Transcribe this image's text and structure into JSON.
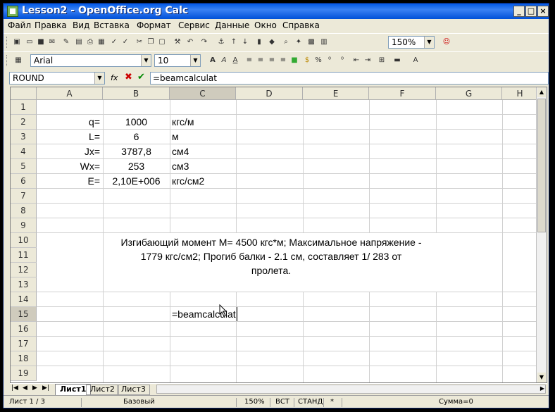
{
  "window": {
    "title": "Lesson2 - OpenOffice.org Calc",
    "controls": [
      "_",
      "□",
      "×"
    ]
  },
  "menu": [
    "Файл",
    "Правка",
    "Вид",
    "Вставка",
    "Формат",
    "Сервис",
    "Данные",
    "Окно",
    "Справка"
  ],
  "toolbar": {
    "zoom": "150%",
    "font_name": "Arial",
    "font_size": "10"
  },
  "formula_bar": {
    "name_box": "ROUND",
    "fx": "fx",
    "cancel": "✖",
    "accept": "✔",
    "content": "=beamcalculat"
  },
  "columns": [
    "A",
    "B",
    "C",
    "D",
    "E",
    "F",
    "G",
    "H"
  ],
  "rows": [
    "1",
    "2",
    "3",
    "4",
    "5",
    "6",
    "7",
    "8",
    "9",
    "10",
    "11",
    "12",
    "13",
    "14",
    "15",
    "16",
    "17",
    "18",
    "19"
  ],
  "cells": {
    "a2": "q=",
    "b2": "1000",
    "c2": "кгс/м",
    "a3": "L=",
    "b3": "6",
    "c3": "м",
    "a4": "Jx=",
    "b4": "3787,8",
    "c4": "см4",
    "a5": "Wx=",
    "b5": "253",
    "c5": "см3",
    "a6": "E=",
    "b6": "2,10E+006",
    "c6": "кгс/см2",
    "c15": "=beamcalculat"
  },
  "result_message": {
    "line1": "Изгибающий момент М=  4500 кгс*м; Максимальное напряжение -",
    "line2": "1779 кгс/см2; Прогиб балки -  2.1 см, составляет 1/ 283 от",
    "line3": "пролета."
  },
  "sheet_tabs": [
    "Лист1",
    "Лист2",
    "Лист3"
  ],
  "status": {
    "sheet": "Лист 1 / 3",
    "style": "Базовый",
    "zoom": "150%",
    "insert_mode": "ВСТ",
    "selection_mode": "СТАНД",
    "modified": "*",
    "sum": "Сумма=0"
  }
}
